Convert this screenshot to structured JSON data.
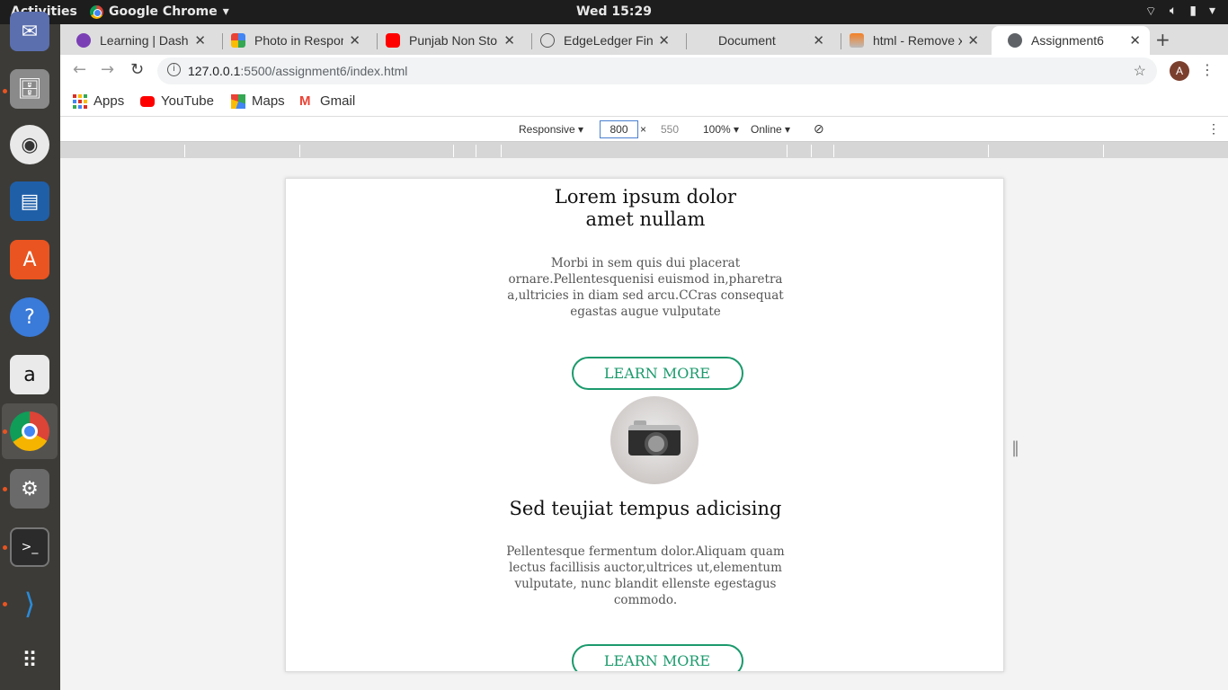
{
  "topbar": {
    "activities": "Activities",
    "app_name": "Google Chrome",
    "clock": "Wed 15:29"
  },
  "dock": {
    "items": [
      "thunderbird-icon",
      "files-icon",
      "rhythmbox-icon",
      "writer-icon",
      "software-icon",
      "help-icon",
      "amazon-icon",
      "chrome-icon",
      "settings-icon",
      "terminal-icon",
      "vscode-icon",
      "show-apps-icon"
    ]
  },
  "tabs": [
    {
      "title": "Learning | Dashboa",
      "fav_color": "#7b3fb5"
    },
    {
      "title": "Photo in Respons",
      "fav_color": "#e8b437"
    },
    {
      "title": "Punjab Non Stop",
      "fav_color": "#ff0000"
    },
    {
      "title": "EdgeLedger Fina",
      "fav_color": "#666666"
    },
    {
      "title": "Document",
      "fav_color": "#dedede"
    },
    {
      "title": "html - Remove x",
      "fav_color": "#f48024"
    },
    {
      "title": "Assignment6",
      "fav_color": "#5f6368"
    }
  ],
  "omnibox": {
    "host": "127.0.0.1",
    "path": ":5500/assignment6/index.html"
  },
  "avatar_letter": "A",
  "bookmarks": [
    {
      "label": "Apps"
    },
    {
      "label": "YouTube"
    },
    {
      "label": "Maps"
    },
    {
      "label": "Gmail"
    }
  ],
  "devtools": {
    "device": "Responsive",
    "width": "800",
    "times": "×",
    "height": "550",
    "zoom": "100%",
    "network": "Online"
  },
  "page": {
    "card1": {
      "title_line1": "Lorem ipsum dolor",
      "title_line2": "amet nullam",
      "text": "Morbi in sem quis dui placerat ornare.Pellentesquenisi euismod in,pharetra a,ultricies in diam sed arcu.CCras consequat egastas augue vulputate",
      "button": "LEARN MORE"
    },
    "card2": {
      "title": "Sed teujiat tempus adicising",
      "text": "Pellentesque fermentum dolor.Aliquam quam lectus facillisis auctor,ultrices ut,elementum vulputate, nunc blandit ellenste egestagus commodo.",
      "button": "LEARN MORE"
    }
  },
  "colors": {
    "accent": "#1c9a6d",
    "dock_bg": "#3c3b37",
    "topbar_bg": "#1d1d1d"
  }
}
